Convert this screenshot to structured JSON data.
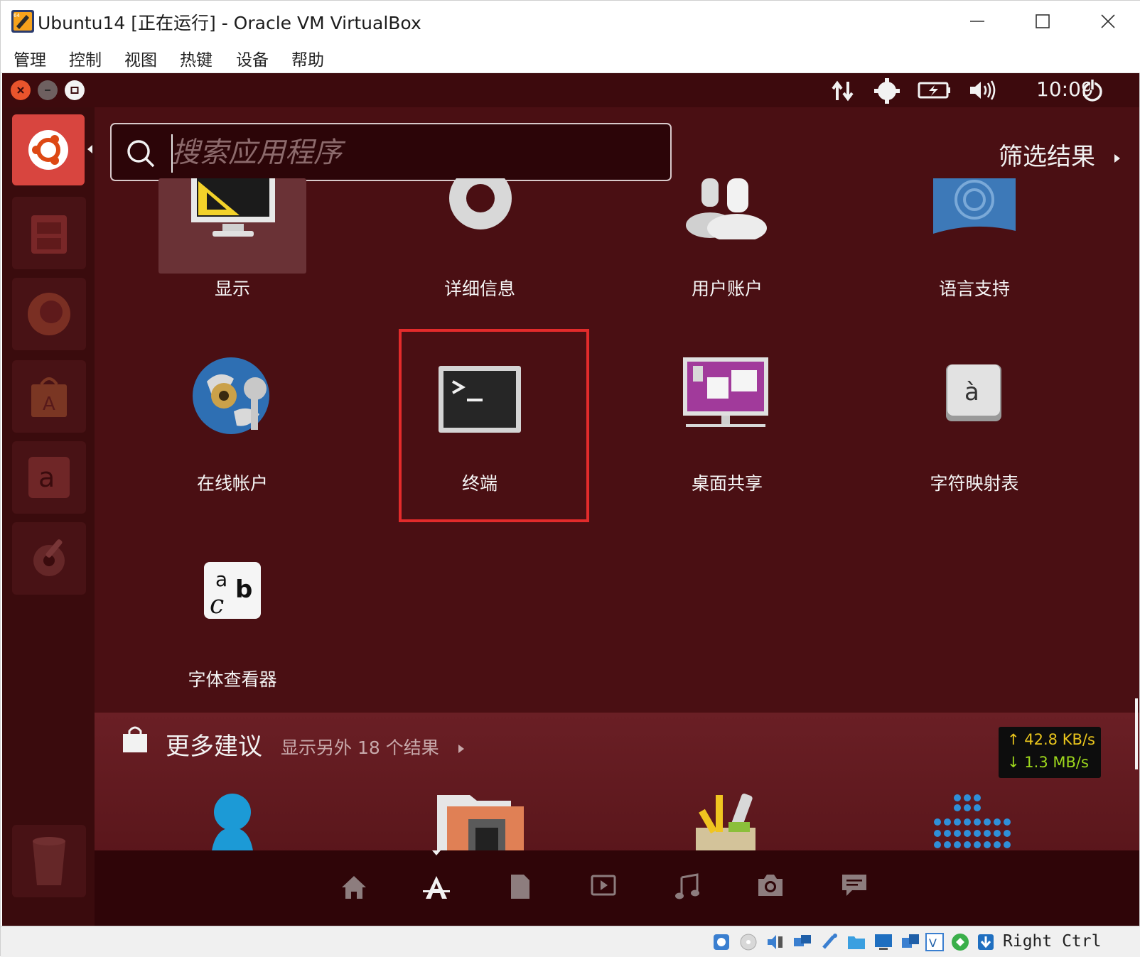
{
  "window": {
    "title": "Ubuntu14 [正在运行] - Oracle VM VirtualBox",
    "controls": [
      "minimize",
      "maximize",
      "close"
    ]
  },
  "menubar": {
    "items": [
      "管理",
      "控制",
      "视图",
      "热键",
      "设备",
      "帮助"
    ]
  },
  "topbar": {
    "clock": "10:09",
    "indicators": [
      "network-arrows-icon",
      "settings-gear-icon",
      "battery-icon",
      "volume-icon",
      "power-icon"
    ]
  },
  "dash": {
    "search_placeholder": "搜索应用程序",
    "filter_label": "筛选结果",
    "apps": [
      {
        "label": "显示",
        "icon": "display-settings-icon",
        "selected": true
      },
      {
        "label": "详细信息",
        "icon": "details-gear-icon"
      },
      {
        "label": "用户账户",
        "icon": "user-accounts-icon"
      },
      {
        "label": "语言支持",
        "icon": "language-support-icon"
      },
      {
        "label": "在线帐户",
        "icon": "online-accounts-icon"
      },
      {
        "label": "终端",
        "icon": "terminal-icon",
        "highlighted": true
      },
      {
        "label": "桌面共享",
        "icon": "desktop-sharing-icon"
      },
      {
        "label": "字符映射表",
        "icon": "character-map-icon"
      },
      {
        "label": "字体查看器",
        "icon": "font-viewer-icon"
      }
    ],
    "more": {
      "title": "更多建议",
      "subtitle": "显示另外 18 个结果",
      "apps": [
        "user-app-icon",
        "files-app-icon",
        "tools-app-icon",
        "dots-app-icon"
      ]
    },
    "lenses": [
      "home-lens-icon",
      "applications-lens-icon",
      "files-lens-icon",
      "video-lens-icon",
      "music-lens-icon",
      "photo-lens-icon",
      "social-lens-icon"
    ]
  },
  "launcher": {
    "items": [
      "ubuntu-dash-icon",
      "file-cabinet-icon",
      "firefox-icon",
      "software-center-icon",
      "amazon-icon",
      "system-settings-icon",
      "trash-icon"
    ]
  },
  "network_widget": {
    "up": "42.8 KB/s",
    "down": "1.3 MB/s"
  },
  "statusbar": {
    "host_key": "Right Ctrl"
  },
  "colors": {
    "dash_bg": "#4a0f13",
    "highlight_box": "#e32b2b",
    "net_text": "#e8c41c"
  }
}
